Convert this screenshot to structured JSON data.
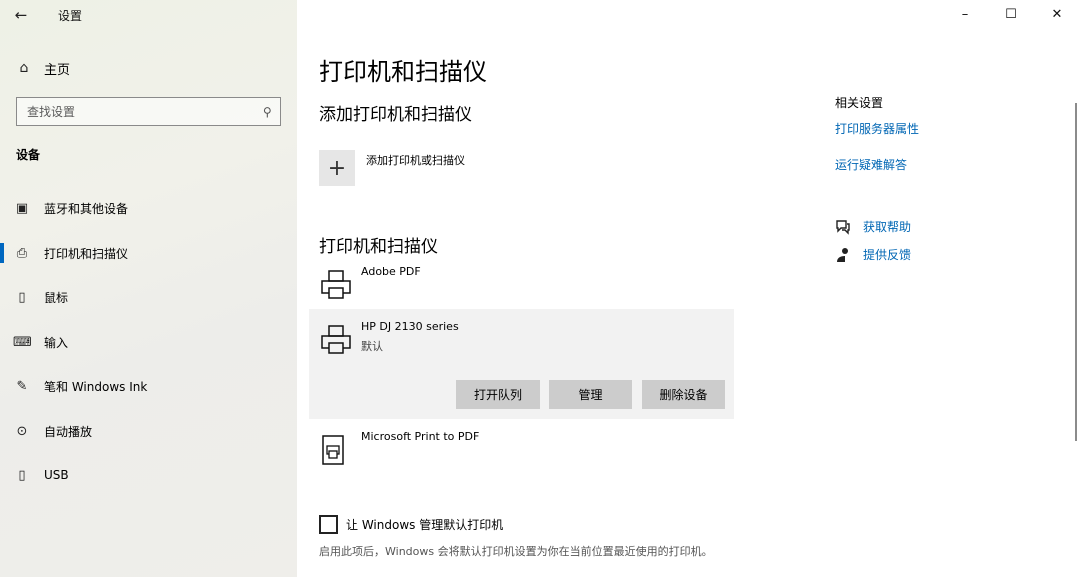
{
  "window": {
    "title": "设置",
    "back_icon": "←",
    "minimize": "–",
    "maximize": "☐",
    "close": "✕"
  },
  "sidebar": {
    "home": {
      "icon": "⌂",
      "label": "主页"
    },
    "search": {
      "placeholder": "查找设置",
      "icon": "⚲"
    },
    "section": "设备",
    "items": [
      {
        "icon": "▣",
        "label": "蓝牙和其他设备"
      },
      {
        "icon": "⎙",
        "label": "打印机和扫描仪"
      },
      {
        "icon": "▯",
        "label": "鼠标"
      },
      {
        "icon": "⌨",
        "label": "输入"
      },
      {
        "icon": "✎",
        "label": "笔和 Windows Ink"
      },
      {
        "icon": "⊙",
        "label": "自动播放"
      },
      {
        "icon": "▯",
        "label": "USB"
      }
    ]
  },
  "main": {
    "title": "打印机和扫描仪",
    "add_section_title": "添加打印机和扫描仪",
    "add_icon": "+",
    "add_label": "添加打印机或扫描仪",
    "printers_section_title": "打印机和扫描仪",
    "printers": [
      {
        "name": "Adobe PDF",
        "status": ""
      },
      {
        "name": "HP DJ 2130 series",
        "status": "默认"
      },
      {
        "name": "Microsoft Print to PDF",
        "status": ""
      }
    ],
    "actions": {
      "open_queue": "打开队列",
      "manage": "管理",
      "remove": "删除设备"
    },
    "checkbox_label": "让 Windows 管理默认打印机",
    "checkbox_checked": false,
    "help_text": "启用此项后，Windows 会将默认打印机设置为你在当前位置最近使用的打印机。"
  },
  "related": {
    "title": "相关设置",
    "links": [
      "打印服务器属性",
      "运行疑难解答"
    ],
    "get_help": "获取帮助",
    "feedback": "提供反馈"
  },
  "colors": {
    "accent": "#0067c0",
    "link": "#0066b4",
    "button": "#cccccc"
  }
}
